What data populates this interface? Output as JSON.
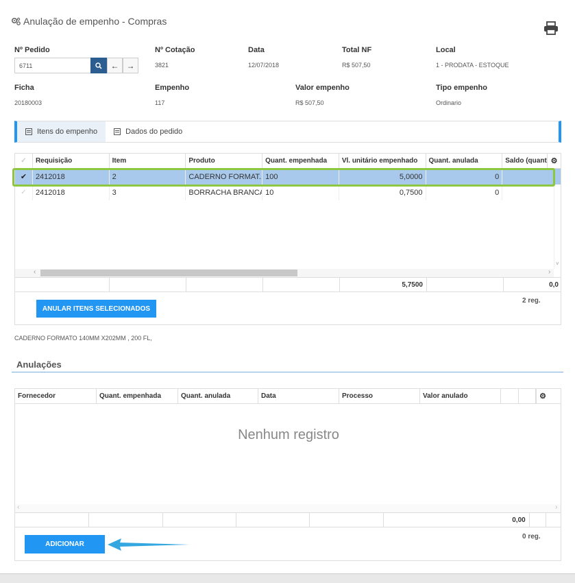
{
  "title": "Anulação de empenho - Compras",
  "fields": {
    "pedido": {
      "label": "Nº Pedido",
      "value": "6711"
    },
    "cotacao": {
      "label": "Nº Cotação",
      "value": "3821"
    },
    "data": {
      "label": "Data",
      "value": "12/07/2018"
    },
    "total_nf": {
      "label": "Total NF",
      "value": "R$ 507,50"
    },
    "local": {
      "label": "Local",
      "value": "1 - PRODATA - ESTOQUE"
    },
    "ficha": {
      "label": "Ficha",
      "value": "20180003"
    },
    "empenho": {
      "label": "Empenho",
      "value": "117"
    },
    "valor_empenho": {
      "label": "Valor empenho",
      "value": "R$ 507,50"
    },
    "tipo_empenho": {
      "label": "Tipo empenho",
      "value": "Ordinario"
    }
  },
  "tabs": [
    {
      "label": "Itens do empenho",
      "active": true
    },
    {
      "label": "Dados do pedido",
      "active": false
    }
  ],
  "items_grid": {
    "columns": [
      "Requisição",
      "Item",
      "Produto",
      "Quant. empenhada",
      "Vl. unitário empenhado",
      "Quant. anulada",
      "Saldo (quanti"
    ],
    "rows": [
      {
        "selected": true,
        "requisicao": "2412018",
        "item": "2",
        "produto": "CADERNO FORMAT...",
        "quant_empenhada": "100",
        "vl_unitario": "5,0000",
        "quant_anulada": "0",
        "saldo": ""
      },
      {
        "selected": false,
        "requisicao": "2412018",
        "item": "3",
        "produto": "BORRACHA BRANCA-",
        "quant_empenhada": "10",
        "vl_unitario": "0,7500",
        "quant_anulada": "0",
        "saldo": ""
      }
    ],
    "footer_total": "5,7500",
    "footer_saldo": "0,0",
    "reg_count": "2 reg.",
    "action_button": "ANULAR ITENS SELECIONADOS"
  },
  "product_description": "CADERNO FORMATO 140MM X202MM , 200 FL,",
  "anulacoes": {
    "section_title": "Anulações",
    "columns": [
      "Fornecedor",
      "Quant. empenhada",
      "Quant. anulada",
      "Data",
      "Processo",
      "Valor anulado"
    ],
    "empty_text": "Nenhum registro",
    "footer_total": "0,00",
    "reg_count": "0 reg.",
    "add_button": "ADICIONAR"
  },
  "colors": {
    "accent": "#2196f3",
    "selection": "#a9c9ec",
    "highlight": "#8dc63f",
    "search_button": "#2c5d90"
  }
}
